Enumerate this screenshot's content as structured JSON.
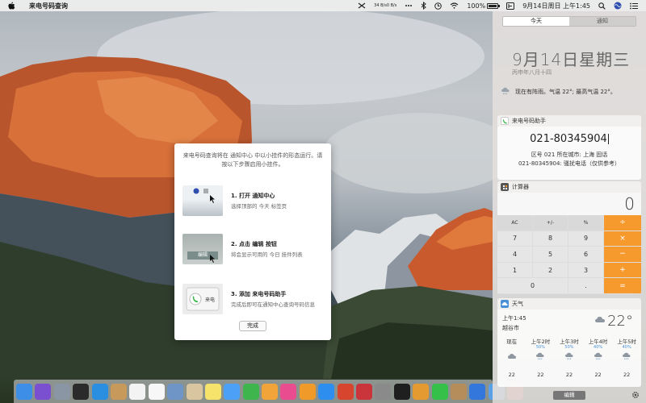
{
  "menubar": {
    "app_name": "来电号码查询",
    "net_up": "34 B/s",
    "net_down": "0 B/s",
    "battery_text": "100%",
    "battery_level": 1.0,
    "datetime": "9月14日周日 上午1:45"
  },
  "notification_center": {
    "tabs": [
      {
        "label": "今天",
        "active": true
      },
      {
        "label": "通知",
        "active": false
      }
    ],
    "date": "9月14日星期三",
    "lunar_date": "丙申年八月十四",
    "weather_summary": "现在有阵雨。气温 22°; 最高气温 22°。",
    "phone_widget": {
      "title": "来电号码助手",
      "number": "021-80345904",
      "region_line": "区号 021 所在城市: 上海 固话",
      "tag_line": "021-80345904: 骚扰电话（仅供参考）"
    },
    "calculator": {
      "title": "计算器",
      "display": "0",
      "keys": [
        "AC",
        "+/-",
        "%",
        "÷",
        "7",
        "8",
        "9",
        "×",
        "4",
        "5",
        "6",
        "−",
        "1",
        "2",
        "3",
        "+",
        "0",
        ".",
        "="
      ]
    },
    "weather": {
      "title": "天气",
      "time": "上午1:45",
      "city": "越谷市",
      "temp": "22°",
      "hours": [
        {
          "label": "现在",
          "pct": "",
          "temp": "22"
        },
        {
          "label": "上午2时",
          "pct": "50%",
          "temp": "22"
        },
        {
          "label": "上午3时",
          "pct": "50%",
          "temp": "22"
        },
        {
          "label": "上午4时",
          "pct": "40%",
          "temp": "22"
        },
        {
          "label": "上午5时",
          "pct": "40%",
          "temp": "22"
        }
      ]
    },
    "edit_label": "编辑"
  },
  "dialog": {
    "title": "来电号码查询将在 通知中心 中以小挂件的形态运行。请按以下步骤启用小挂件。",
    "steps": [
      {
        "title": "1. 打开 通知中心",
        "desc": "选择顶部的 今天 标签页"
      },
      {
        "title": "2. 点击 编辑 按钮",
        "desc": "将会显示可用的 今日 挂件列表",
        "thumb_label": "编辑"
      },
      {
        "title": "3. 添加 来电号码助手",
        "desc": "完成后即可在通知中心查询号码信息",
        "thumb_label": "来电"
      }
    ],
    "done_label": "完成"
  },
  "dock": {
    "icons": [
      {
        "name": "finder-icon",
        "color": "#3d8ee6"
      },
      {
        "name": "siri-icon",
        "color": "#7a4fd0"
      },
      {
        "name": "launchpad-icon",
        "color": "#8b96a5"
      },
      {
        "name": "mission-control-icon",
        "color": "#2b2b2b"
      },
      {
        "name": "safari-icon",
        "color": "#2a8fe0"
      },
      {
        "name": "contacts-icon",
        "color": "#c79a5b"
      },
      {
        "name": "calendar-icon",
        "color": "#f3f3f3"
      },
      {
        "name": "reminders-icon",
        "color": "#f7f7f7"
      },
      {
        "name": "preview-icon",
        "color": "#6f95c7"
      },
      {
        "name": "photos-preview-icon",
        "color": "#d9c6a0"
      },
      {
        "name": "notes-icon",
        "color": "#f5e36b"
      },
      {
        "name": "messages-icon",
        "color": "#4ca0f5"
      },
      {
        "name": "facetime-icon",
        "color": "#3fb64d"
      },
      {
        "name": "photos-icon",
        "color": "#f0a43a"
      },
      {
        "name": "itunes-icon",
        "color": "#e94d8f"
      },
      {
        "name": "ibooks-icon",
        "color": "#f09a2a"
      },
      {
        "name": "app-store-icon",
        "color": "#2d8ef0"
      },
      {
        "name": "podcast-icon",
        "color": "#d8452e"
      },
      {
        "name": "music-player-icon",
        "color": "#c9353a"
      },
      {
        "name": "system-preferences-icon",
        "color": "#8a8a8a"
      },
      {
        "name": "terminal-icon",
        "color": "#1f1f1f"
      },
      {
        "name": "butterfly-icon",
        "color": "#e49a30"
      },
      {
        "name": "line-icon",
        "color": "#35c04a"
      },
      {
        "name": "package-icon",
        "color": "#b48d5a"
      },
      {
        "name": "blue-app-icon",
        "color": "#3377dd"
      },
      {
        "name": "safari-alt-icon",
        "color": "#5aa0e8"
      },
      {
        "name": "screenshot-app-icon",
        "color": "#d84a3a"
      }
    ]
  }
}
